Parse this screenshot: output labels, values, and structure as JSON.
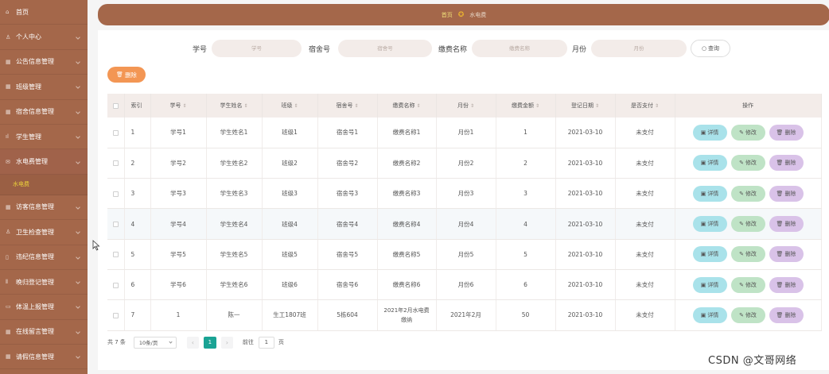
{
  "sidebar": {
    "items": [
      {
        "label": "首页",
        "icon": "home-icon",
        "glyph": "⌂"
      },
      {
        "label": "个人中心",
        "icon": "user-icon",
        "glyph": "♙"
      },
      {
        "label": "公告信息管理",
        "icon": "grid-icon",
        "glyph": "▦"
      },
      {
        "label": "班级管理",
        "icon": "grid-icon",
        "glyph": "▦"
      },
      {
        "label": "宿舍信息管理",
        "icon": "grid-icon",
        "glyph": "▦"
      },
      {
        "label": "学生管理",
        "icon": "chart-icon",
        "glyph": "ıl"
      },
      {
        "label": "水电费管理",
        "icon": "mail-icon",
        "glyph": "✉",
        "open": true,
        "sub": "水电费"
      },
      {
        "label": "访客信息管理",
        "icon": "grid-icon",
        "glyph": "▦"
      },
      {
        "label": "卫生检查管理",
        "icon": "user-icon",
        "glyph": "♙"
      },
      {
        "label": "违纪信息管理",
        "icon": "doc-icon",
        "glyph": "▯"
      },
      {
        "label": "晚归登记管理",
        "icon": "columns-icon",
        "glyph": "⫴"
      },
      {
        "label": "体温上报管理",
        "icon": "doc-icon",
        "glyph": "▭"
      },
      {
        "label": "在线留言管理",
        "icon": "grid-icon",
        "glyph": "▦"
      },
      {
        "label": "请假信息管理",
        "icon": "grid-icon",
        "glyph": "▦"
      }
    ]
  },
  "breadcrumb": {
    "home": "首页",
    "separator": "✪",
    "current": "水电费"
  },
  "search": {
    "fields": [
      {
        "label": "学号",
        "placeholder": "学号"
      },
      {
        "label": "宿舍号",
        "placeholder": "宿舍号"
      },
      {
        "label": "缴费名称",
        "placeholder": "缴费名称"
      },
      {
        "label": "月份",
        "placeholder": "月份"
      }
    ],
    "button": "查询",
    "button_icon": "○"
  },
  "toolbar": {
    "delete": "删除",
    "delete_icon": "🗑"
  },
  "table": {
    "columns": [
      "索引",
      "学号",
      "学生姓名",
      "班级",
      "宿舍号",
      "缴费名称",
      "月份",
      "缴费金额",
      "登记日期",
      "是否支付",
      "操作"
    ],
    "sortable_mark": "⇕",
    "rows": [
      [
        "1",
        "学号1",
        "学生姓名1",
        "班级1",
        "宿舍号1",
        "缴费名称1",
        "月份1",
        "1",
        "2021-03-10",
        "未支付"
      ],
      [
        "2",
        "学号2",
        "学生姓名2",
        "班级2",
        "宿舍号2",
        "缴费名称2",
        "月份2",
        "2",
        "2021-03-10",
        "未支付"
      ],
      [
        "3",
        "学号3",
        "学生姓名3",
        "班级3",
        "宿舍号3",
        "缴费名称3",
        "月份3",
        "3",
        "2021-03-10",
        "未支付"
      ],
      [
        "4",
        "学号4",
        "学生姓名4",
        "班级4",
        "宿舍号4",
        "缴费名称4",
        "月份4",
        "4",
        "2021-03-10",
        "未支付"
      ],
      [
        "5",
        "学号5",
        "学生姓名5",
        "班级5",
        "宿舍号5",
        "缴费名称5",
        "月份5",
        "5",
        "2021-03-10",
        "未支付"
      ],
      [
        "6",
        "学号6",
        "学生姓名6",
        "班级6",
        "宿舍号6",
        "缴费名称6",
        "月份6",
        "6",
        "2021-03-10",
        "未支付"
      ],
      [
        "7",
        "1",
        "陈一",
        "生工1807班",
        "5栋604",
        "2021年2月水电费缴纳",
        "2021年2月",
        "50",
        "2021-03-10",
        "未支付"
      ]
    ],
    "actions": {
      "detail": "详情",
      "edit": "修改",
      "delete": "删除",
      "detail_icon": "▣",
      "edit_icon": "✎",
      "delete_icon": "🗑"
    }
  },
  "pagination": {
    "total": "共 7 条",
    "page_size": "10条/页",
    "prev": "‹",
    "next": "›",
    "current_page": "1",
    "goto_label": "前往",
    "goto_value": "1",
    "page_unit": "页"
  },
  "watermark": "CSDN @文哥网络",
  "colors": {
    "sidebar": "#a4674a",
    "accent_orange": "#f39654",
    "page_active": "#1aa394",
    "detail": "#a9e2ea",
    "edit": "#bfe3c6",
    "delete": "#d9c2e8"
  }
}
